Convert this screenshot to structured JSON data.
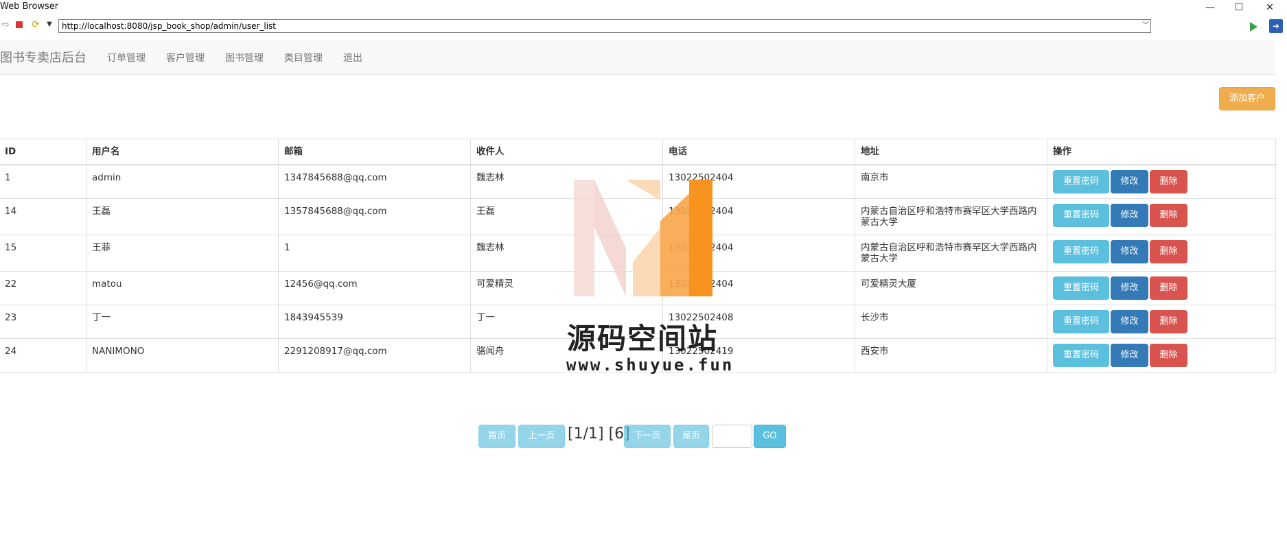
{
  "window": {
    "title": "Web Browser",
    "minimize": "—",
    "maximize": "☐",
    "close": "✕"
  },
  "browser": {
    "url": "http://localhost:8080/jsp_book_shop/admin/user_list"
  },
  "navbar": {
    "brand": "图书专卖店后台",
    "links": [
      "订单管理",
      "客户管理",
      "图书管理",
      "类目管理",
      "退出"
    ]
  },
  "actions": {
    "add_customer": "添加客户"
  },
  "table": {
    "headers": [
      "ID",
      "用户名",
      "邮箱",
      "收件人",
      "电话",
      "地址",
      "操作"
    ],
    "rows": [
      {
        "id": "1",
        "username": "admin",
        "email": "1347845688@qq.com",
        "recipient": "魏志林",
        "phone": "13022502404",
        "address": "南京市"
      },
      {
        "id": "14",
        "username": "王磊",
        "email": "1357845688@qq.com",
        "recipient": "王磊",
        "phone": "13022502404",
        "address": "内蒙古自治区呼和浩特市赛罕区大学西路内蒙古大学"
      },
      {
        "id": "15",
        "username": "王菲",
        "email": "1",
        "recipient": "魏志林",
        "phone": "13022502404",
        "address": "内蒙古自治区呼和浩特市赛罕区大学西路内蒙古大学"
      },
      {
        "id": "22",
        "username": "matou",
        "email": "12456@qq.com",
        "recipient": "可爱精灵",
        "phone": "13022502404",
        "address": "可爱精灵大厦"
      },
      {
        "id": "23",
        "username": "丁一",
        "email": "1843945539",
        "recipient": "丁一",
        "phone": "13022502408",
        "address": "长沙市"
      },
      {
        "id": "24",
        "username": "NANIMONO",
        "email": "2291208917@qq.com",
        "recipient": "骆闻舟",
        "phone": "13022502419",
        "address": "西安市"
      }
    ],
    "row_buttons": {
      "reset": "重置密码",
      "edit": "修改",
      "delete": "删除"
    }
  },
  "pagination": {
    "first": "首页",
    "prev": "上一页",
    "info": "[1/1] [6]",
    "next": "下一页",
    "last": "尾页",
    "go": "GO"
  },
  "watermark": {
    "text": "源码空间站",
    "url": "www.shuyue.fun"
  },
  "colors": {
    "warning": "#f0ad4e",
    "info": "#5bc0de",
    "primary": "#337ab7",
    "danger": "#d9534f",
    "accent_orange": "#f7931e"
  }
}
